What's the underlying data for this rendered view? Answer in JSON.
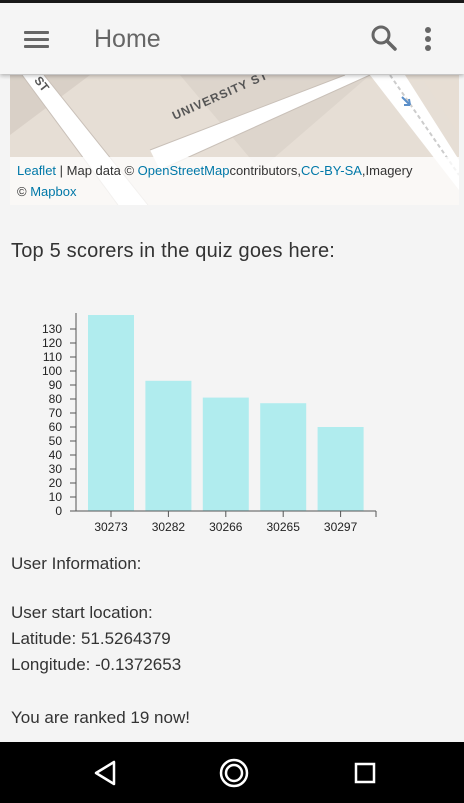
{
  "app_bar": {
    "title": "Home",
    "icons": {
      "menu": "menu-icon",
      "search": "search-icon",
      "more": "more-vert-icon"
    }
  },
  "map": {
    "street_label": "UNIVERSITY ST",
    "attribution": {
      "leaflet": "Leaflet",
      "sep": " | Map data © ",
      "osm": "OpenStreetMap",
      "contributors": "contributors,",
      "license": "CC-BY-SA",
      "imagery": ",Imagery",
      "copy": "© ",
      "mapbox": "Mapbox"
    }
  },
  "quiz": {
    "heading": "Top 5 scorers in the quiz goes here:"
  },
  "chart_data": {
    "type": "bar",
    "categories": [
      "30273",
      "30282",
      "30266",
      "30265",
      "30297"
    ],
    "values": [
      140,
      93,
      81,
      77,
      60
    ],
    "ylim": [
      0,
      140
    ],
    "yticks": [
      0,
      10,
      20,
      30,
      40,
      50,
      60,
      70,
      80,
      90,
      100,
      110,
      120,
      130
    ],
    "bar_color": "#b0ecee"
  },
  "user_info": {
    "label": "User Information:",
    "start_location_label": "User start location:",
    "latitude": "Latitude: 51.5264379",
    "longitude": "Longitude: -0.1372653",
    "rank": "You are ranked 19 now!"
  },
  "nav_bar": {
    "icons": {
      "back": "back-triangle-icon",
      "home": "home-circle-icon",
      "recents": "recents-square-icon"
    }
  }
}
